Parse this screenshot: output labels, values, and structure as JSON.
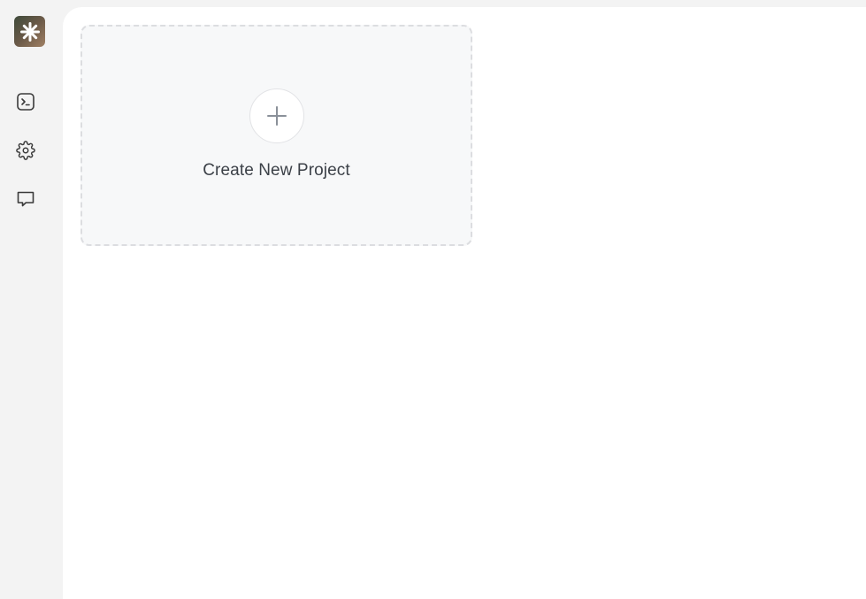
{
  "sidebar": {
    "logo_icon": "asterisk-flower-icon",
    "items": [
      {
        "icon": "terminal-icon"
      },
      {
        "icon": "gear-icon"
      },
      {
        "icon": "chat-bubble-icon"
      }
    ]
  },
  "main": {
    "create_card": {
      "icon": "plus-icon",
      "label": "Create New Project"
    }
  },
  "colors": {
    "sidebar_bg": "#f3f3f3",
    "main_bg": "#ffffff",
    "card_bg": "#f7f8f9",
    "card_border": "#dcdde0",
    "text": "#3c4148",
    "icon": "#3a3a3a",
    "plus": "#8a9099"
  }
}
